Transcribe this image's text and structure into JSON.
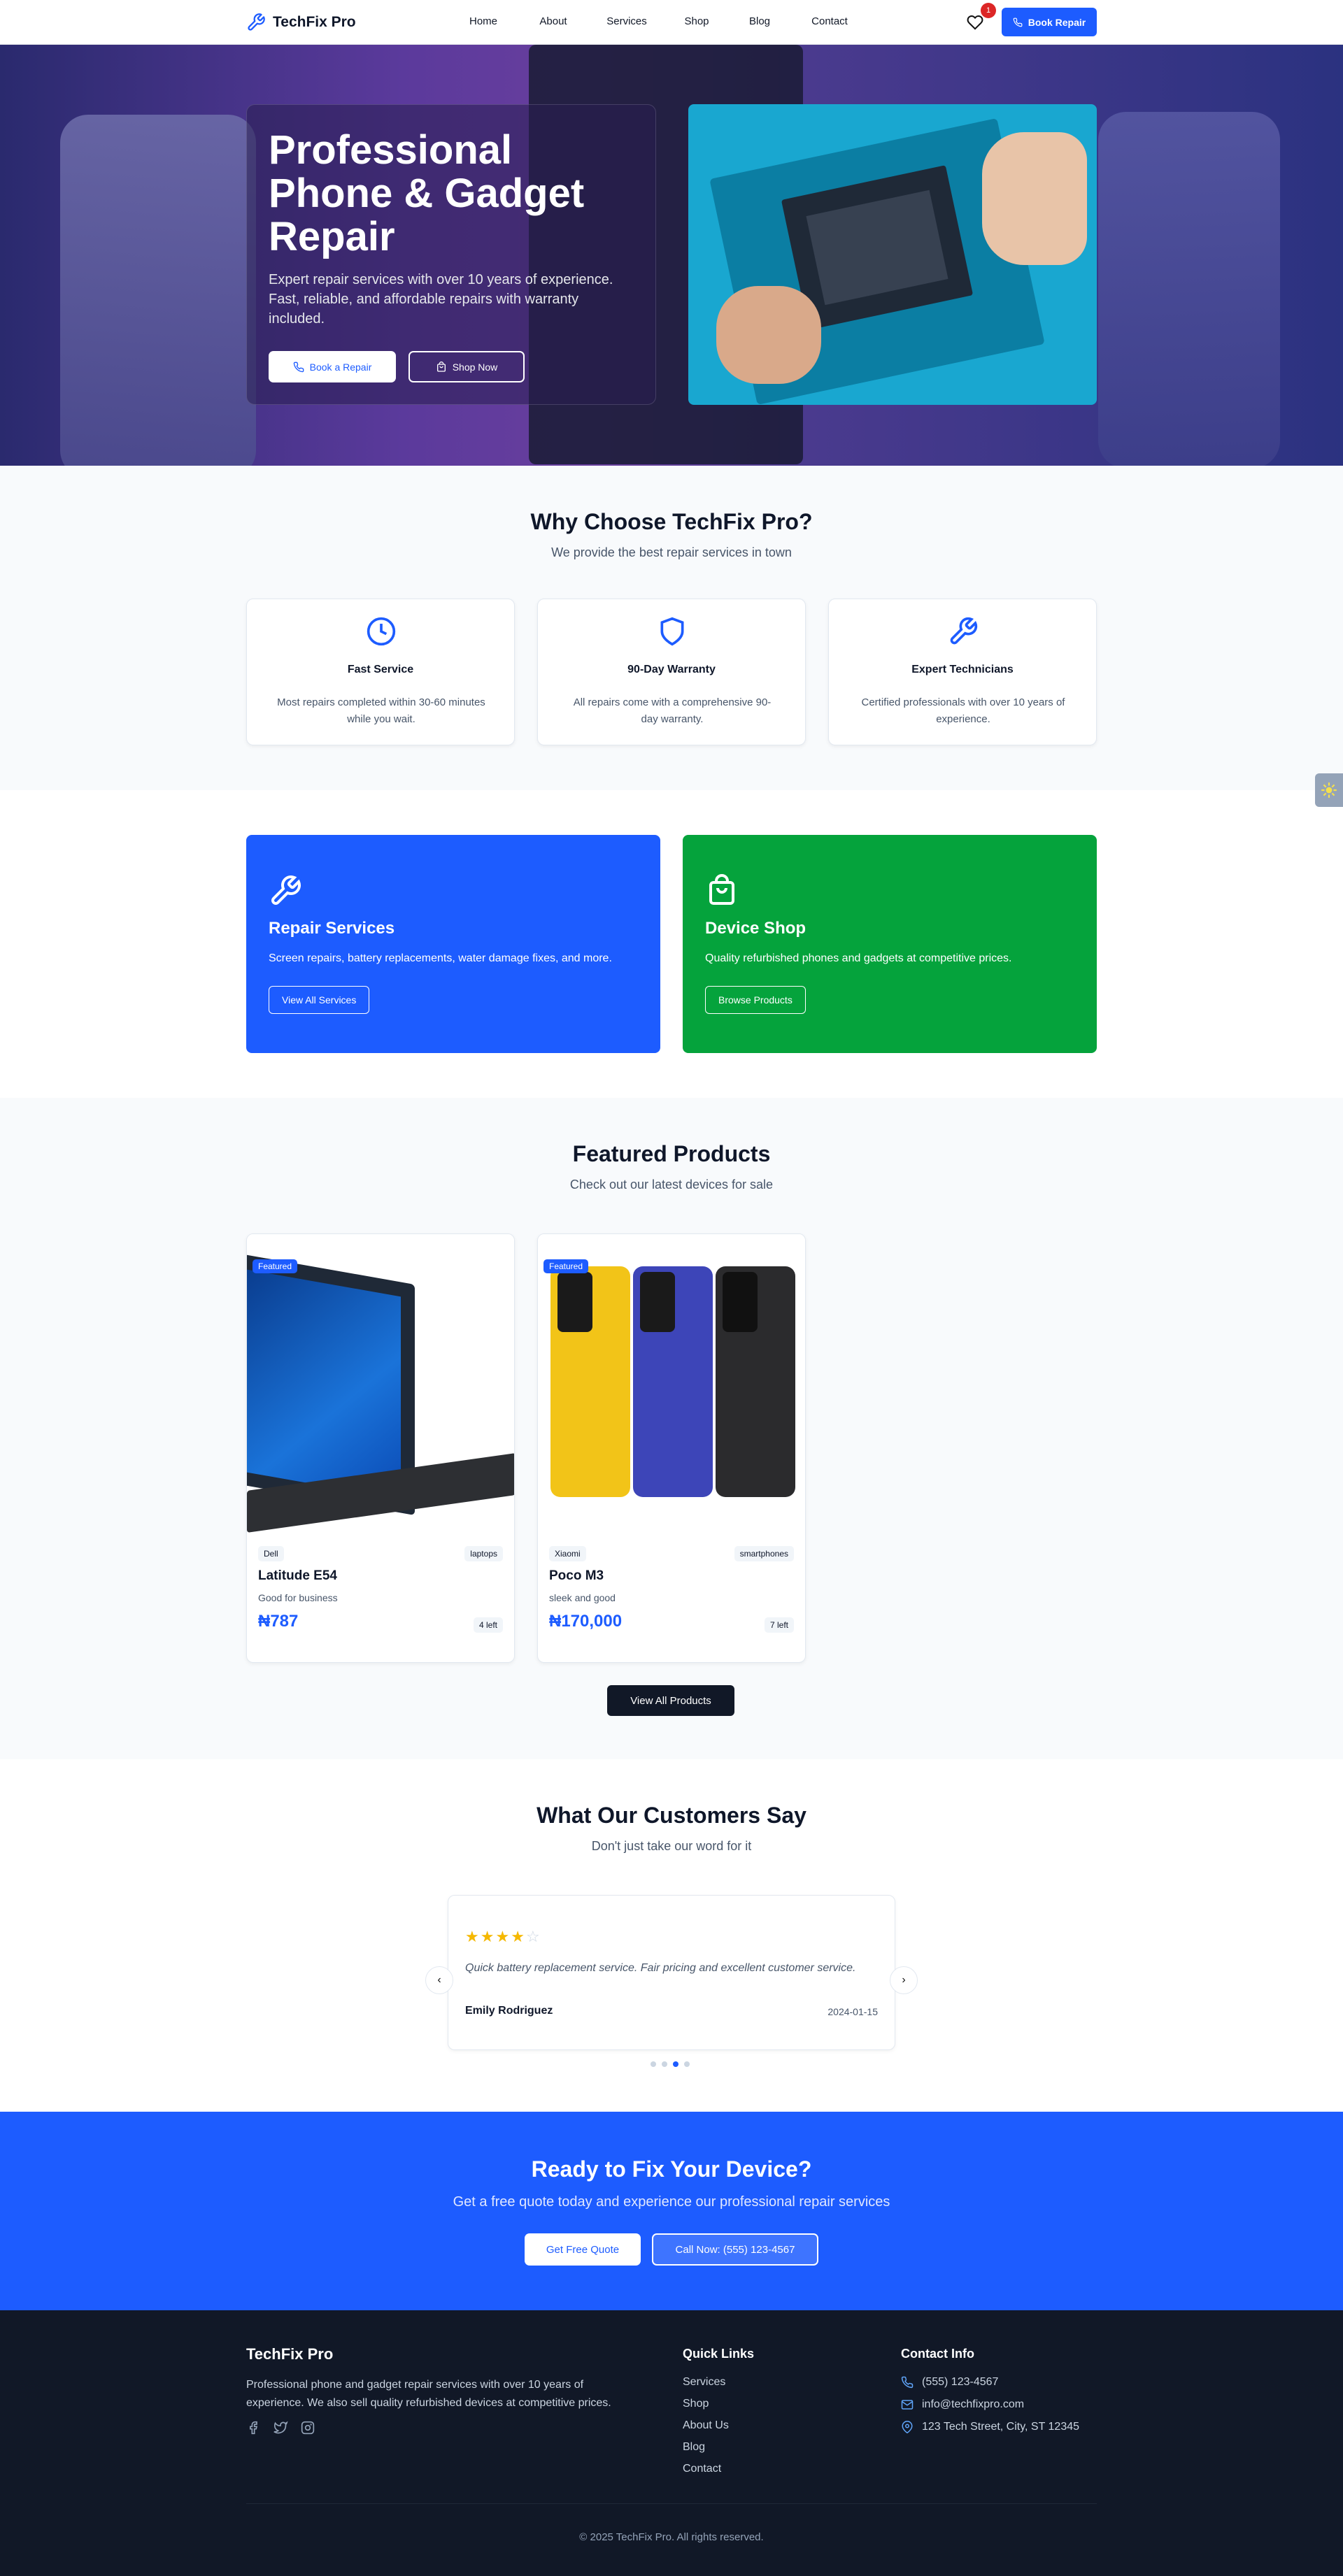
{
  "nav": {
    "brand": "TechFix Pro",
    "links": [
      "Home",
      "About",
      "Services",
      "Shop",
      "Blog",
      "Contact"
    ],
    "wishlist_count": "1",
    "book_label": "Book Repair"
  },
  "hero": {
    "title": "Professional Phone & Gadget Repair",
    "subtitle": "Expert repair services with over 10 years of experience. Fast, reliable, and affordable repairs with warranty included.",
    "book_label": "Book a Repair",
    "shop_label": "Shop Now"
  },
  "why": {
    "title": "Why Choose TechFix Pro?",
    "subtitle": "We provide the best repair services in town",
    "features": [
      {
        "title": "Fast Service",
        "desc": "Most repairs completed within 30-60 minutes while you wait.",
        "icon": "clock-icon"
      },
      {
        "title": "90-Day Warranty",
        "desc": "All repairs come with a comprehensive 90-day warranty.",
        "icon": "shield-icon"
      },
      {
        "title": "Expert Technicians",
        "desc": "Certified professionals with over 10 years of experience.",
        "icon": "wrench-icon"
      }
    ]
  },
  "promos": {
    "repair": {
      "title": "Repair Services",
      "desc": "Screen repairs, battery replacements, water damage fixes, and more.",
      "button": "View All Services",
      "color": "#1d5cff"
    },
    "shop": {
      "title": "Device Shop",
      "desc": "Quality refurbished phones and gadgets at competitive prices.",
      "button": "Browse Products",
      "color": "#05a33c"
    }
  },
  "products": {
    "title": "Featured Products",
    "subtitle": "Check out our latest devices for sale",
    "items": [
      {
        "badge": "Featured",
        "brand": "Dell",
        "category": "laptops",
        "name": "Latitude E54",
        "desc": "Good for business",
        "price": "₦787",
        "stock": "4 left"
      },
      {
        "badge": "Featured",
        "brand": "Xiaomi",
        "category": "smartphones",
        "name": "Poco M3",
        "desc": "sleek and good",
        "price": "₦170,000",
        "stock": "7 left"
      }
    ],
    "view_all": "View All Products"
  },
  "testimonials": {
    "title": "What Our Customers Say",
    "subtitle": "Don't just take our word for it",
    "rating": 4,
    "quote": "Quick battery replacement service. Fair pricing and excellent customer service.",
    "name": "Emily Rodriguez",
    "date": "2024-01-15",
    "active_dot": 2,
    "dot_count": 4
  },
  "cta": {
    "title": "Ready to Fix Your Device?",
    "subtitle": "Get a free quote today and experience our professional repair services",
    "quote_label": "Get Free Quote",
    "call_label": "Call Now: (555) 123-4567"
  },
  "footer": {
    "brand": "TechFix Pro",
    "desc": "Professional phone and gadget repair services with over 10 years of experience. We also sell quality refurbished devices at competitive prices.",
    "quick_links_title": "Quick Links",
    "quick_links": [
      "Services",
      "Shop",
      "About Us",
      "Blog",
      "Contact"
    ],
    "contact_title": "Contact Info",
    "phone": "(555) 123-4567",
    "email": "info@techfixpro.com",
    "address": "123 Tech Street, City, ST 12345",
    "copyright": "© 2025 TechFix Pro. All rights reserved."
  },
  "colors": {
    "primary": "#1d5cff",
    "green": "#05a33c",
    "dark": "#111827",
    "star": "#f5b800"
  }
}
